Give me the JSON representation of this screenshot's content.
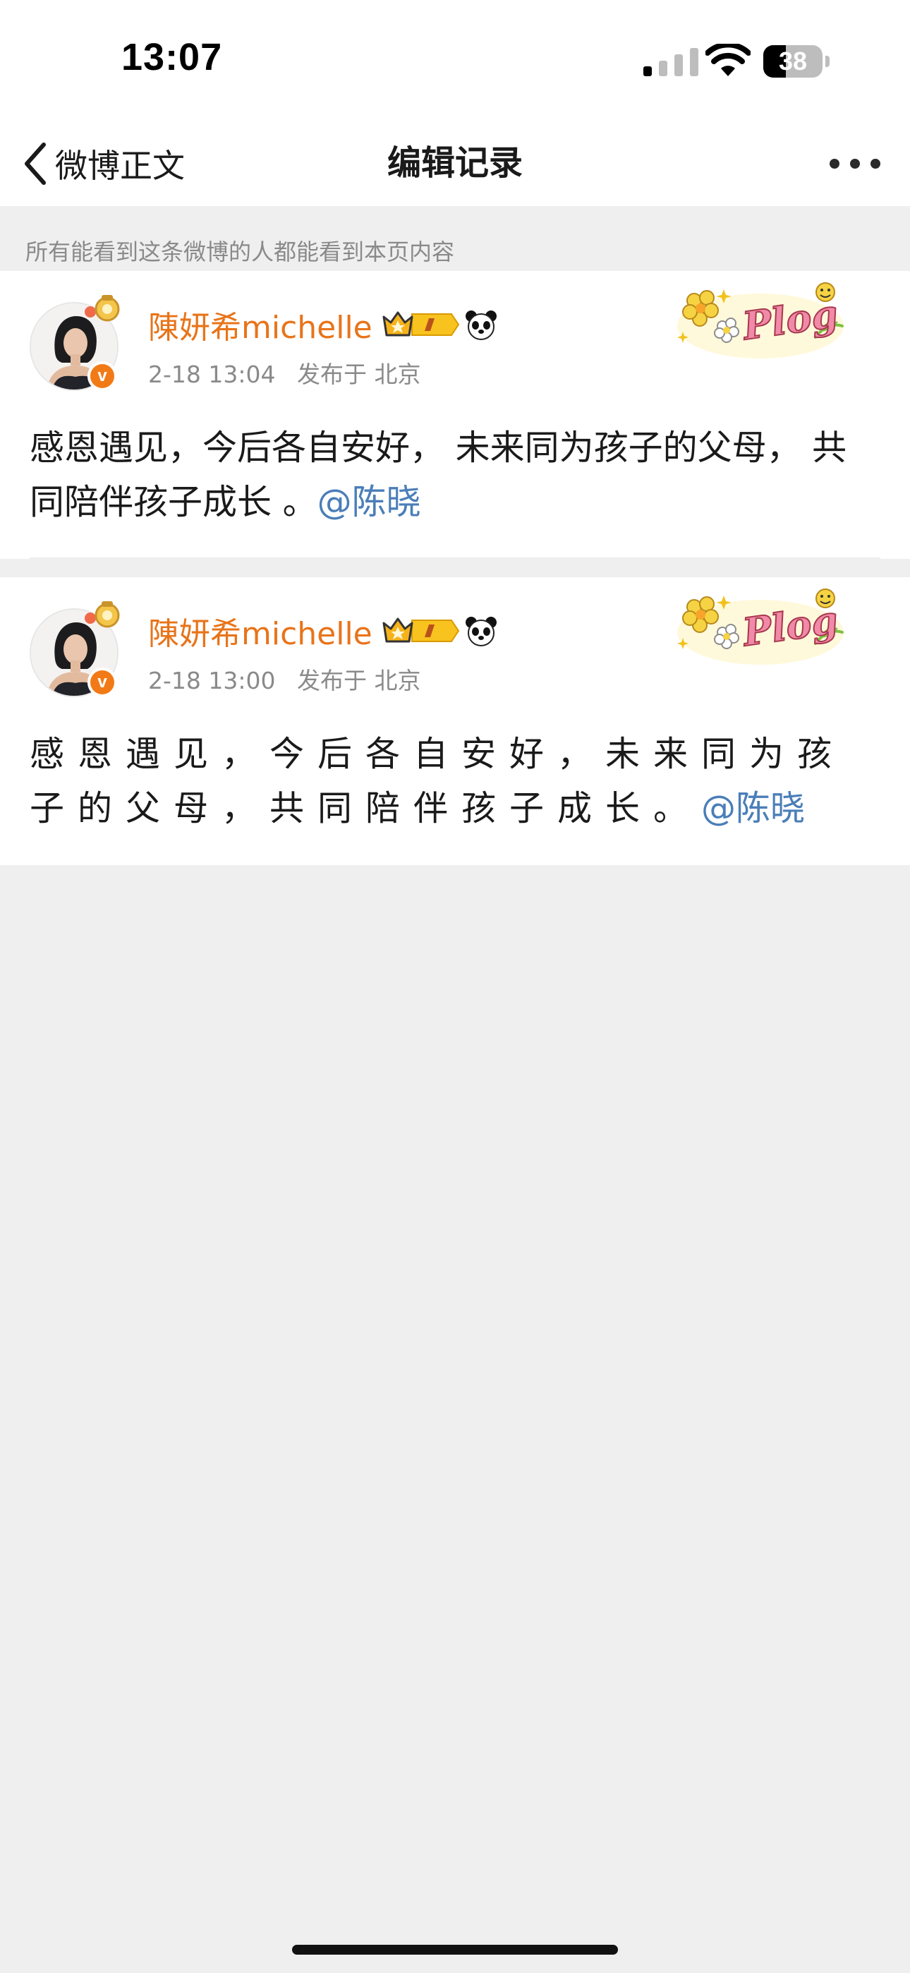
{
  "status_bar": {
    "time": "13:07",
    "battery": "38",
    "battery_level": 0.38,
    "icons": [
      "cellular-signal-icon",
      "wifi-icon",
      "battery-icon"
    ]
  },
  "nav": {
    "back_label": "微博正文",
    "title": "编辑记录",
    "icons": [
      "chevron-left-icon",
      "more-icon"
    ]
  },
  "notice": "所有能看到这条微博的人都能看到本页内容",
  "posts": [
    {
      "username": "陳妍希michelle",
      "time": "2-18 13:04",
      "location": "发布于 北京",
      "body": "感恩遇见，今后各自安好， 未来同为孩子的父母， 共同陪伴孩子成长 。",
      "mention": "@陈晓",
      "sticker_text": "Plog",
      "badges": [
        "vip-crown-badge",
        "panda-icon",
        "verified-icon"
      ]
    },
    {
      "username": "陳妍希michelle",
      "time": "2-18 13:00",
      "location": "发布于 北京",
      "body": "感恩遇见，今后各自安好，未来同为孩子的父母，共同陪伴孩子成长。",
      "mention": "@陈晓",
      "sticker_text": "Plog",
      "badges": [
        "vip-crown-badge",
        "panda-icon",
        "verified-icon"
      ]
    }
  ],
  "colors": {
    "username": "#e8741a",
    "mention": "#4a7eb8",
    "muted_text": "#8a8a8a",
    "page_background": "#efefef",
    "verified_badge": "#f27a16"
  }
}
